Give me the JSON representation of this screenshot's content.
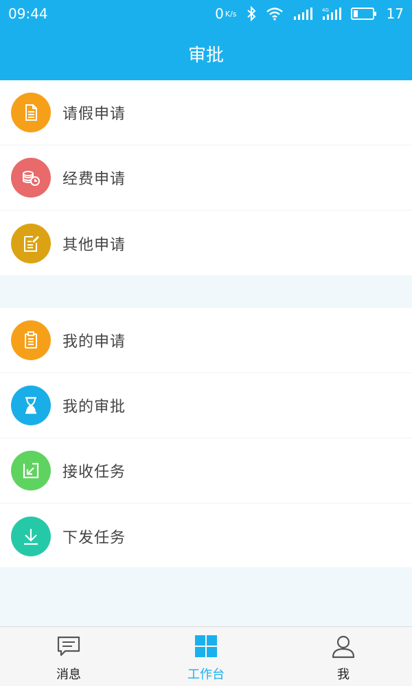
{
  "status_bar": {
    "time": "09:44",
    "speed_value": "0",
    "speed_unit": "K/s",
    "battery": "17"
  },
  "title": "审批",
  "apply_group": [
    {
      "label": "请假申请",
      "icon": "document-icon",
      "color": "#f6a01a"
    },
    {
      "label": "经费申请",
      "icon": "coins-clock-icon",
      "color": "#e86a6a"
    },
    {
      "label": "其他申请",
      "icon": "edit-note-icon",
      "color": "#dba314"
    }
  ],
  "task_group": [
    {
      "label": "我的申请",
      "icon": "clipboard-icon",
      "color": "#f6a01a"
    },
    {
      "label": "我的审批",
      "icon": "hourglass-icon",
      "color": "#19aee8"
    },
    {
      "label": "接收任务",
      "icon": "receive-arrow-icon",
      "color": "#5fd35f"
    },
    {
      "label": "下发任务",
      "icon": "download-icon",
      "color": "#25c9a7"
    }
  ],
  "tabs": [
    {
      "label": "消息",
      "icon": "message-icon",
      "active": false
    },
    {
      "label": "工作台",
      "icon": "grid-icon",
      "active": true
    },
    {
      "label": "我",
      "icon": "user-icon",
      "active": false
    }
  ],
  "colors": {
    "primary": "#1ab0ee",
    "page_bg": "#f1f8fc"
  }
}
